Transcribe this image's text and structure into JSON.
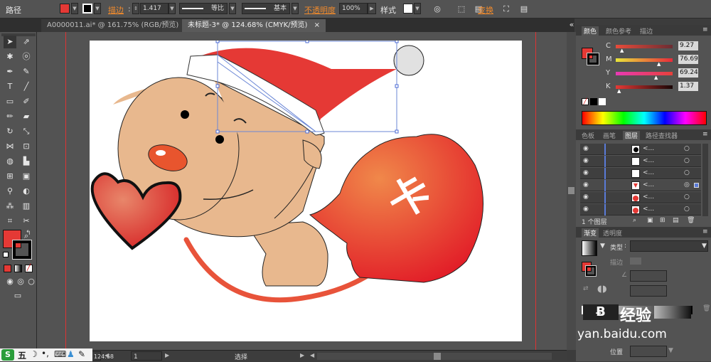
{
  "control_bar": {
    "label_path": "路径",
    "label_stroke": "描边",
    "stroke_weight": "1.417",
    "profile_uniform": "等比",
    "brush_basic": "基本",
    "label_opacity": "不透明度",
    "opacity_value": "100%",
    "label_style": "样式",
    "label_transform": "变换",
    "fill_color": "#e53935",
    "stroke_color": "#000000"
  },
  "tabs": [
    {
      "label": "A0000011.ai* @ 161.75% (RGB/预览)"
    },
    {
      "label": "未标题-3* @ 124.68% (CMYK/预览)"
    }
  ],
  "status": {
    "zoom": "124.68",
    "page": "1",
    "mode": "选择"
  },
  "color_panel": {
    "tabs": [
      "颜色",
      "颜色参考",
      "描边"
    ],
    "c_label": "C",
    "c_value": "9.27",
    "m_label": "M",
    "m_value": "76.69",
    "y_label": "Y",
    "y_value": "69.24",
    "k_label": "K",
    "k_value": "1.37",
    "fill_color": "#e53935"
  },
  "layers_panel": {
    "tabs": [
      "色板",
      "画笔",
      "图层",
      "路径查找器"
    ],
    "footer": "1 个图层",
    "rows": [
      {
        "name": "<..."
      },
      {
        "name": "<..."
      },
      {
        "name": "<..."
      },
      {
        "name": "<..."
      },
      {
        "name": "<..."
      },
      {
        "name": "<..."
      }
    ]
  },
  "gradient_panel": {
    "tabs": [
      "渐变",
      "透明度"
    ],
    "type_label": "类型",
    "stroke_label": "描边",
    "position_label": "位置"
  },
  "taskbar": {
    "ime_label": "五"
  },
  "watermark": {
    "text_top": "经验",
    "text_bottom": "yan.baidu.com"
  },
  "artwork": {
    "label_glyph": "卡"
  }
}
